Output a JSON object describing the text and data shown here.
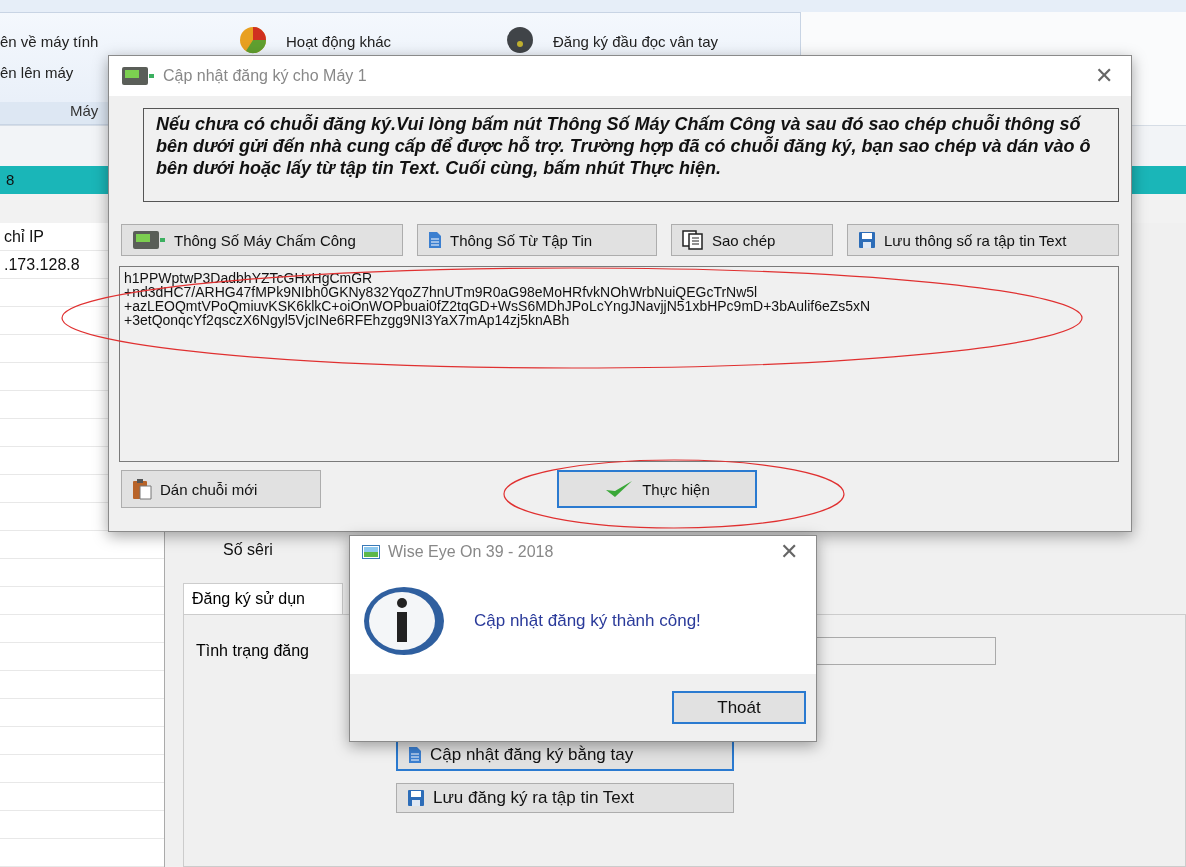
{
  "background_app": {
    "ribbon": {
      "left_items": [
        "ên về máy tính",
        "ên lên máy"
      ],
      "group_label": "Máy",
      "buttons": [
        {
          "label": "Hoạt động khác"
        },
        {
          "label": "Đăng ký đầu đọc vân tay"
        }
      ]
    },
    "teal_bar": {
      "text": "8"
    },
    "device_list": {
      "header": "chỉ IP",
      "rows": [
        ".173.128.8"
      ]
    },
    "detail": {
      "serial_label": "Số sêri",
      "tab": "Đăng ký sử dụn",
      "status_label": "Tình trạng đăng",
      "buttons": [
        {
          "label": "Cập nhật đăng ký bằng tay",
          "focused": true
        },
        {
          "label": "Lưu đăng ký ra tập tin Text",
          "focused": false
        }
      ]
    }
  },
  "dialog": {
    "title": "Cập nhật đăng ký cho Máy 1",
    "close": "✕",
    "instructions": "Nếu chưa có chuỗi đăng ký.Vui lòng bấm nút Thông Số Máy Chấm Công và sau đó sao chép chuỗi thông số bên dưới gửi đến nhà cung cấp để được hỗ trợ. Trường hợp đã có chuỗi đăng ký, bạn sao chép và dán vào ô bên dưới hoặc lấy từ tập tin Text. Cuối cùng, bấm nhút Thực hiện.",
    "toolbar": [
      {
        "label": "Thông Số Máy Chấm Công"
      },
      {
        "label": "Thông Số Từ Tập Tin"
      },
      {
        "label": "Sao chép"
      },
      {
        "label": "Lưu thông số ra tập tin Text"
      }
    ],
    "registration_text": "h1PPWptwP3DadbhYZTcGHxHgCmGR\n+nd3dHC7/ARHG47fMPk9NIbh0GKNy832YqoZ7hnUTm9R0aG98eMoHRfvkNOhWrbNuiQEGcTrNw5l\n+azLEOQmtVPoQmiuvKSK6klkC+oiOnWOPbuai0fZ2tqGD+WsS6MDhJPoLcYngJNavjjN51xbHPc9mD+3bAulif6eZs5xN\n+3etQonqcYf2qsczX6Ngyl5VjcINe6RFEhzgg9NI3YaX7mAp14zj5knABh",
    "paste_button": {
      "label": "Dán chuỗi mới",
      "focused": false
    },
    "execute_button": {
      "label": "Thực hiện",
      "focused": true
    }
  },
  "message_box": {
    "title": "Wise Eye On 39 - 2018",
    "close": "✕",
    "message": "Cập nhật đăng ký thành công!",
    "button": {
      "label": "Thoát",
      "focused": true
    }
  }
}
